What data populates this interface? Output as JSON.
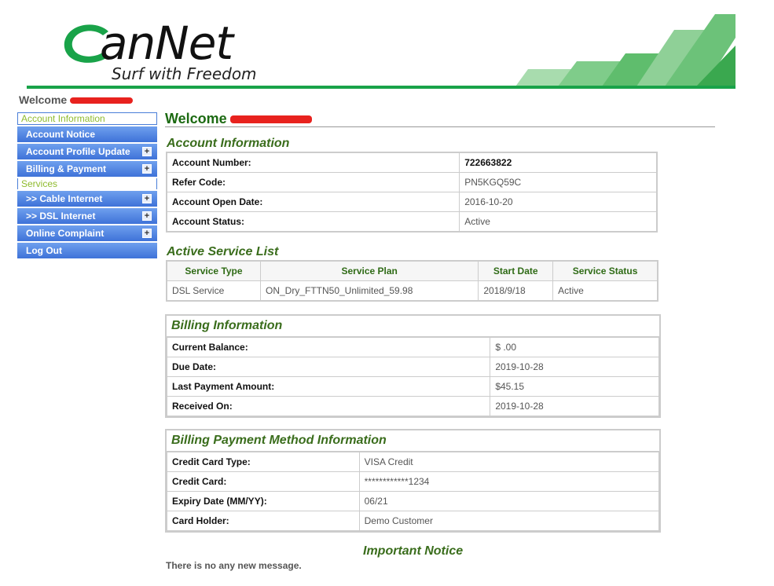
{
  "brand": {
    "name": "anNet",
    "tagline": "Surf with Freedom",
    "colors": {
      "green": "#19a349",
      "title_green": "#3a6d1c",
      "nav_blue": "#4a7ed8",
      "category_green": "#8fbb2e"
    }
  },
  "header": {
    "welcome": "Welcome"
  },
  "sidebar": {
    "category_account": "Account Information",
    "category_services": "Services",
    "items": [
      {
        "label": "Account Notice",
        "expandable": false
      },
      {
        "label": "Account Profile Update",
        "expandable": true
      },
      {
        "label": "Billing & Payment",
        "expandable": true
      }
    ],
    "service_items": [
      {
        "label": ">> Cable Internet",
        "expandable": true
      },
      {
        "label": ">> DSL Internet",
        "expandable": true
      },
      {
        "label": "Online Complaint",
        "expandable": true
      },
      {
        "label": "Log Out",
        "expandable": false
      }
    ],
    "expand_glyph": "+"
  },
  "main": {
    "welcome": "Welcome",
    "account_info": {
      "title": "Account Information",
      "rows": [
        {
          "label": "Account Number:",
          "value": "722663822"
        },
        {
          "label": "Refer Code:",
          "value": "PN5KGQ59C"
        },
        {
          "label": "Account Open Date:",
          "value": "2016-10-20"
        },
        {
          "label": "Account Status:",
          "value": "Active"
        }
      ]
    },
    "services": {
      "title": "Active Service List",
      "headers": [
        "Service Type",
        "Service Plan",
        "Start Date",
        "Service Status"
      ],
      "rows": [
        [
          "DSL Service",
          "ON_Dry_FTTN50_Unlimited_59.98",
          "2018/9/18",
          "Active"
        ]
      ]
    },
    "billing": {
      "title": "Billing Information",
      "rows": [
        {
          "label": "Current Balance:",
          "value": "$ .00"
        },
        {
          "label": "Due Date:",
          "value": "2019-10-28"
        },
        {
          "label": "Last Payment Amount:",
          "value": "$45.15"
        },
        {
          "label": "Received On:",
          "value": "2019-10-28"
        }
      ]
    },
    "payment_method": {
      "title": "Billing Payment Method Information",
      "rows": [
        {
          "label": "Credit Card Type:",
          "value": "VISA Credit"
        },
        {
          "label": "Credit Card:",
          "value": "************1234"
        },
        {
          "label": "Expiry Date (MM/YY):",
          "value": "06/21"
        },
        {
          "label": "Card Holder:",
          "value": "Demo Customer"
        }
      ]
    },
    "notice": {
      "title": "Important Notice",
      "text": "There is no any new message."
    }
  }
}
